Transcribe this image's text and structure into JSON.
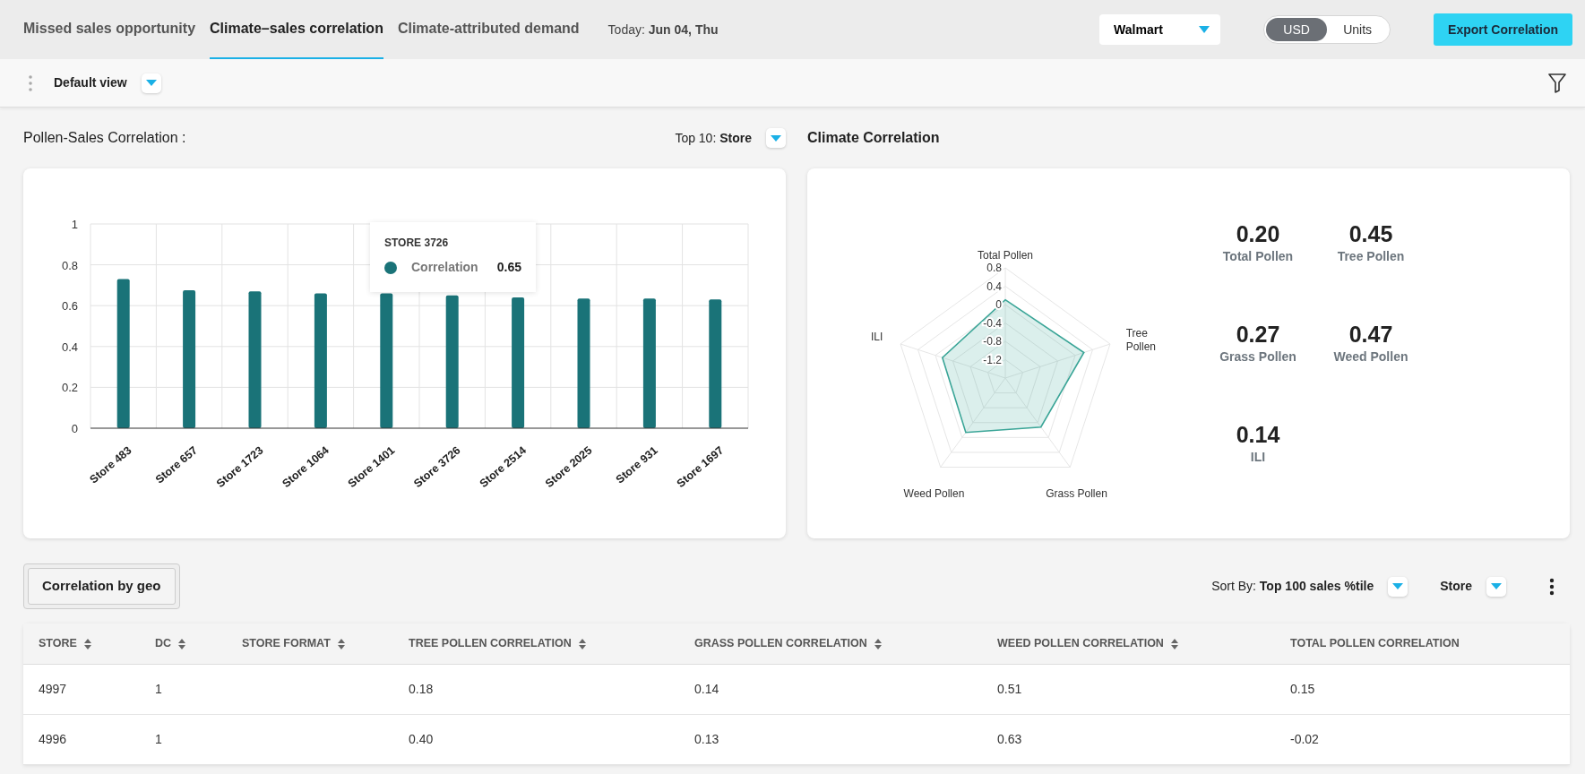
{
  "tabs": [
    {
      "label": "Missed sales opportunity",
      "selected": false
    },
    {
      "label": "Climate–sales correlation",
      "selected": true
    },
    {
      "label": "Climate-attributed demand",
      "selected": false
    }
  ],
  "today": {
    "label": "Today:",
    "value": "Jun 04, Thu"
  },
  "retailer_select": {
    "value": "Walmart"
  },
  "metric_toggle": [
    {
      "label": "USD",
      "selected": true
    },
    {
      "label": "Units",
      "selected": false
    }
  ],
  "export_button": "Export Correlation",
  "view_select": {
    "value": "Default view"
  },
  "pollen_sales": {
    "title": "Pollen-Sales Correlation :",
    "top_label": "Top 10:",
    "top_value": "Store",
    "tooltip": {
      "title": "STORE 3726",
      "value": "0.65"
    },
    "chart_data": {
      "type": "bar",
      "grid": true,
      "categories": [
        "Store 483",
        "Store 657",
        "Store 1723",
        "Store 1064",
        "Store 1401",
        "Store 3726",
        "Store 2514",
        "Store 2025",
        "Store 931",
        "Store 1697"
      ],
      "series": [
        {
          "name": "Correlation",
          "color": "#1a7378",
          "values": [
            0.73,
            0.675,
            0.67,
            0.66,
            0.66,
            0.65,
            0.64,
            0.635,
            0.635,
            0.63
          ]
        }
      ],
      "ylim": [
        0,
        1
      ],
      "yticks": [
        {
          "value": 0,
          "label": "0"
        },
        {
          "value": 0.2,
          "label": "0.2"
        },
        {
          "value": 0.4,
          "label": "0.4"
        },
        {
          "value": 0.6,
          "label": "0.6"
        },
        {
          "value": 0.8,
          "label": "0.8"
        },
        {
          "value": 1,
          "label": "1"
        }
      ]
    }
  },
  "climate": {
    "title": "Climate Correlation",
    "radar": {
      "axis_labels": [
        "Total Pollen",
        "Tree Pollen",
        "Grass Pollen",
        "Weed Pollen",
        "ILI"
      ],
      "tick_labels": [
        "0.8",
        "0.4",
        "0",
        "-0.4",
        "-0.8",
        "-1.2"
      ]
    },
    "stats": [
      {
        "value": "0.20",
        "label": "Total Pollen"
      },
      {
        "value": "0.45",
        "label": "Tree Pollen"
      },
      {
        "value": "0.27",
        "label": "Grass Pollen"
      },
      {
        "value": "0.47",
        "label": "Weed Pollen"
      },
      {
        "value": "0.14",
        "label": "ILI"
      }
    ]
  },
  "geo": {
    "button": "Correlation by geo",
    "sort_label": "Sort By:",
    "sort_value": "Top 100 sales %tile",
    "group_value": "Store"
  },
  "table": {
    "columns": [
      {
        "label": "STORE",
        "sortable": true
      },
      {
        "label": "DC",
        "sortable": true
      },
      {
        "label": "STORE FORMAT",
        "sortable": true
      },
      {
        "label": "TREE POLLEN CORRELATION",
        "sortable": true
      },
      {
        "label": "GRASS POLLEN CORRELATION",
        "sortable": true
      },
      {
        "label": "WEED POLLEN CORRELATION",
        "sortable": true
      },
      {
        "label": "TOTAL POLLEN CORRELATION",
        "sortable": false
      }
    ],
    "rows": [
      [
        "4997",
        "1",
        null,
        "0.18",
        "0.14",
        "0.51",
        "0.15"
      ],
      [
        "4996",
        "1",
        null,
        "0.40",
        "0.13",
        "0.63",
        "-0.02"
      ]
    ]
  }
}
